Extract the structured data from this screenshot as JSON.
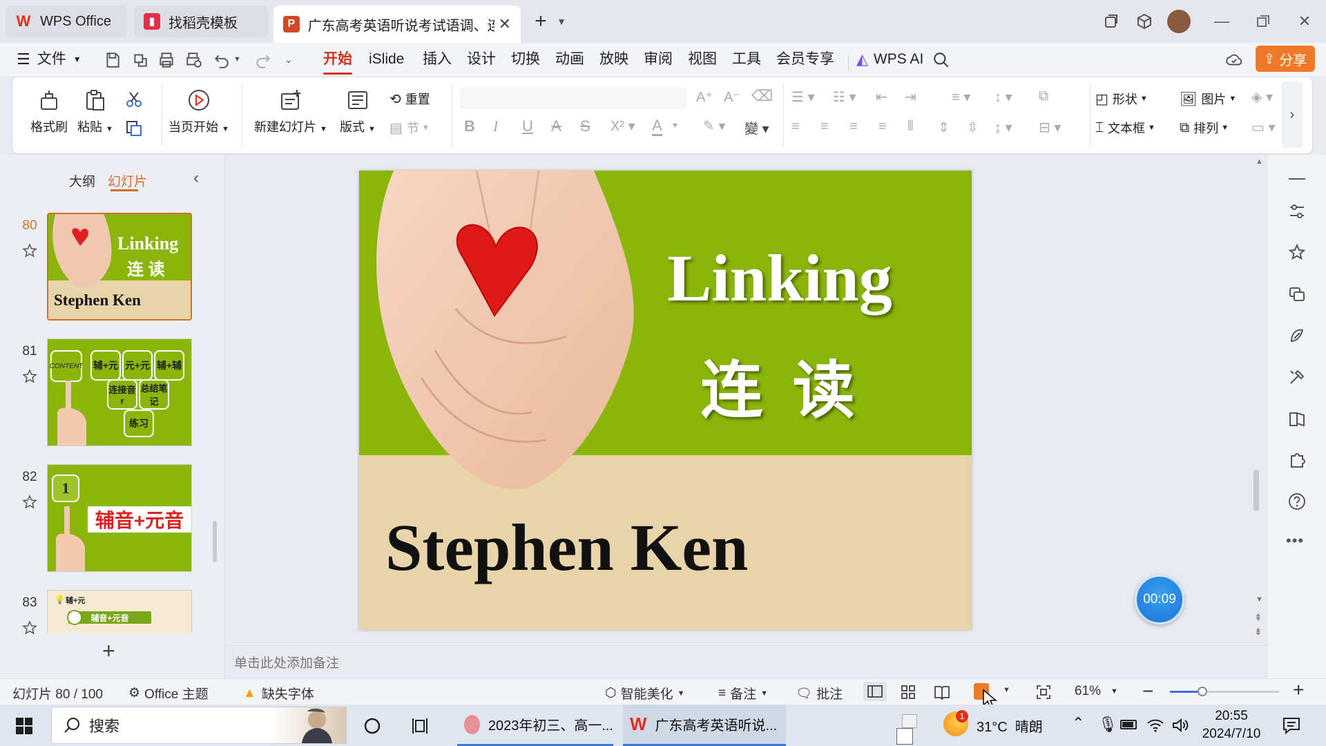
{
  "titlebar": {
    "tabs": [
      {
        "label": "WPS Office",
        "icon": "wps-logo-icon"
      },
      {
        "label": "找稻壳模板",
        "icon": "docer-icon"
      },
      {
        "label": "广东高考英语听说考试语调、连读",
        "icon": "ppt-icon",
        "active": true
      }
    ],
    "add_tab": "+"
  },
  "menubar": {
    "file": "文件",
    "items": [
      "开始",
      "iSlide",
      "插入",
      "设计",
      "切换",
      "动画",
      "放映",
      "审阅",
      "视图",
      "工具",
      "会员专享"
    ],
    "active": "开始",
    "wps_ai": "WPS AI",
    "share": "分享"
  },
  "ribbon": {
    "format_painter": "格式刷",
    "paste": "粘贴",
    "from_current": "当页开始",
    "new_slide": "新建幻灯片",
    "layout": "版式",
    "reset": "重置",
    "section": "节",
    "shape": "形状",
    "picture": "图片",
    "textbox": "文本框",
    "arrange": "排列"
  },
  "leftpanel": {
    "tab_outline": "大纲",
    "tab_slides": "幻灯片",
    "slides": [
      {
        "num": "80",
        "title": "Linking",
        "subtitle": "连 读",
        "author": "Stephen Ken"
      },
      {
        "num": "81",
        "cells": [
          "CONTENT",
          "辅+元",
          "元+元",
          "辅+辅",
          "连接音r",
          "总结笔记",
          "练习"
        ]
      },
      {
        "num": "82",
        "badge": "1",
        "title": "辅音+元音"
      },
      {
        "num": "83",
        "label": "辅+元",
        "title": "辅音+元音"
      }
    ],
    "add": "+"
  },
  "slide": {
    "title": "Linking",
    "subtitle": "连 读",
    "author": "Stephen Ken",
    "colors": {
      "green": "#8ab50a",
      "beige": "#e8d4a8"
    }
  },
  "notes_placeholder": "单击此处添加备注",
  "timer": "00:09",
  "statusbar": {
    "slide_counter": "幻灯片 80 / 100",
    "theme": "Office 主题",
    "missing_font": "缺失字体",
    "beautify": "智能美化",
    "notes": "备注",
    "comments": "批注",
    "zoom": "61%",
    "zoom_level": 0.3
  },
  "taskbar": {
    "search": "搜索",
    "apps": [
      "2023年初三、高一...",
      "广东高考英语听说..."
    ],
    "weather": "31°C  晴朗",
    "weather_badge": "1",
    "time": "20:55",
    "date": "2024/7/10"
  }
}
